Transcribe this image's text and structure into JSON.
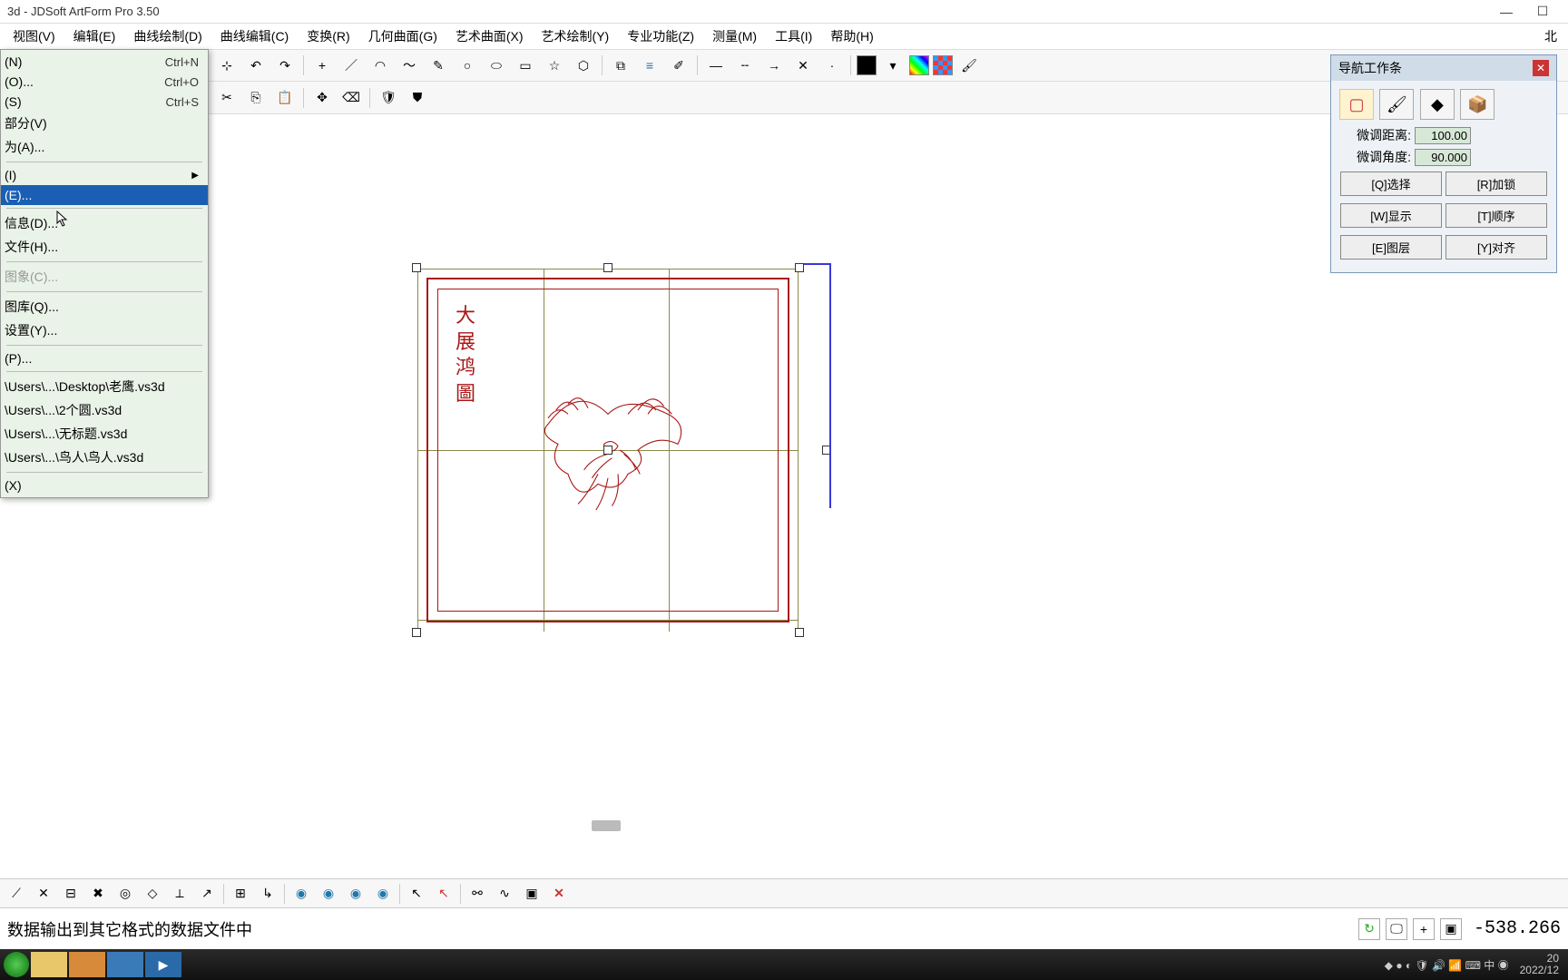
{
  "title": "3d - JDSoft ArtForm Pro 3.50",
  "menubar": {
    "items": [
      "视图(V)",
      "编辑(E)",
      "曲线绘制(D)",
      "曲线编辑(C)",
      "变换(R)",
      "几何曲面(G)",
      "艺术曲面(X)",
      "艺术绘制(Y)",
      "专业功能(Z)",
      "测量(M)",
      "工具(I)",
      "帮助(H)"
    ],
    "right": "北"
  },
  "dropdown": {
    "items": [
      {
        "label": "(N)",
        "shortcut": "Ctrl+N"
      },
      {
        "label": "(O)...",
        "shortcut": "Ctrl+O"
      },
      {
        "label": "(S)",
        "shortcut": "Ctrl+S"
      },
      {
        "label": "部分(V)"
      },
      {
        "label": "为(A)..."
      },
      {
        "sep": true
      },
      {
        "label": "(I)",
        "submenu": true
      },
      {
        "label": "(E)...",
        "highlight": true
      },
      {
        "sep": true
      },
      {
        "label": "信息(D)..."
      },
      {
        "label": "文件(H)..."
      },
      {
        "sep": true
      },
      {
        "label": "图象(C)...",
        "disabled": true
      },
      {
        "sep": true
      },
      {
        "label": "图库(Q)..."
      },
      {
        "label": "设置(Y)..."
      },
      {
        "sep": true
      },
      {
        "label": "(P)..."
      },
      {
        "sep": true
      },
      {
        "label": "\\Users\\...\\Desktop\\老鹰.vs3d"
      },
      {
        "label": "\\Users\\...\\2个圆.vs3d"
      },
      {
        "label": "\\Users\\...\\无标题.vs3d"
      },
      {
        "label": "\\Users\\...\\鸟人\\鸟人.vs3d"
      },
      {
        "sep": true
      },
      {
        "label": "(X)"
      }
    ]
  },
  "nav_panel": {
    "title": "导航工作条",
    "dist_label": "微调距离:",
    "dist_value": "100.00",
    "angle_label": "微调角度:",
    "angle_value": "90.000",
    "buttons": [
      [
        "[Q]选择",
        "[R]加锁"
      ],
      [
        "[W]显示",
        "[T]顺序"
      ],
      [
        "[E]图层",
        "[Y]对齐"
      ]
    ]
  },
  "seal": "大展鸿圖",
  "status_text": "数据输出到其它格式的数据文件中",
  "coord": "-538.266",
  "date": "2022/12",
  "year": "20"
}
